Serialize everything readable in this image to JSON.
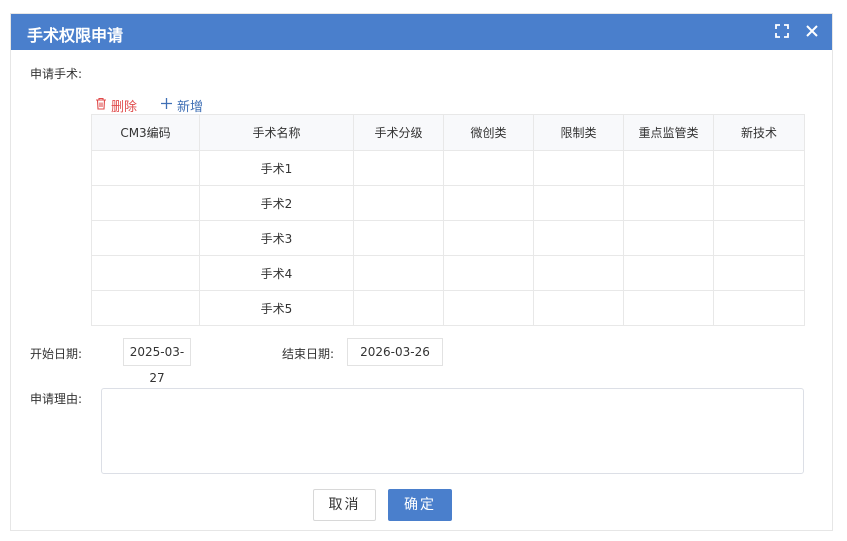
{
  "dialog": {
    "title": "手术权限申请",
    "maximize_icon": "maximize-icon",
    "close_icon": "close-icon",
    "accent_color": "#4a7fcc"
  },
  "surgery": {
    "label": "申请手术:",
    "delete_label": "删除",
    "add_label": "新增",
    "columns": [
      "CM3编码",
      "手术名称",
      "手术分级",
      "微创类",
      "限制类",
      "重点监管类",
      "新技术"
    ],
    "rows": [
      [
        "",
        "手术1",
        "",
        "",
        "",
        "",
        ""
      ],
      [
        "",
        "手术2",
        "",
        "",
        "",
        "",
        ""
      ],
      [
        "",
        "手术3",
        "",
        "",
        "",
        "",
        ""
      ],
      [
        "",
        "手术4",
        "",
        "",
        "",
        "",
        ""
      ],
      [
        "",
        "手术5",
        "",
        "",
        "",
        "",
        ""
      ]
    ]
  },
  "dates": {
    "start_label": "开始日期:",
    "start_value": "2025-03-27",
    "end_label": "结束日期:",
    "end_value": "2026-03-26"
  },
  "reason": {
    "label": "申请理由:",
    "value": ""
  },
  "actions": {
    "cancel_label": "取消",
    "ok_label": "确定"
  }
}
